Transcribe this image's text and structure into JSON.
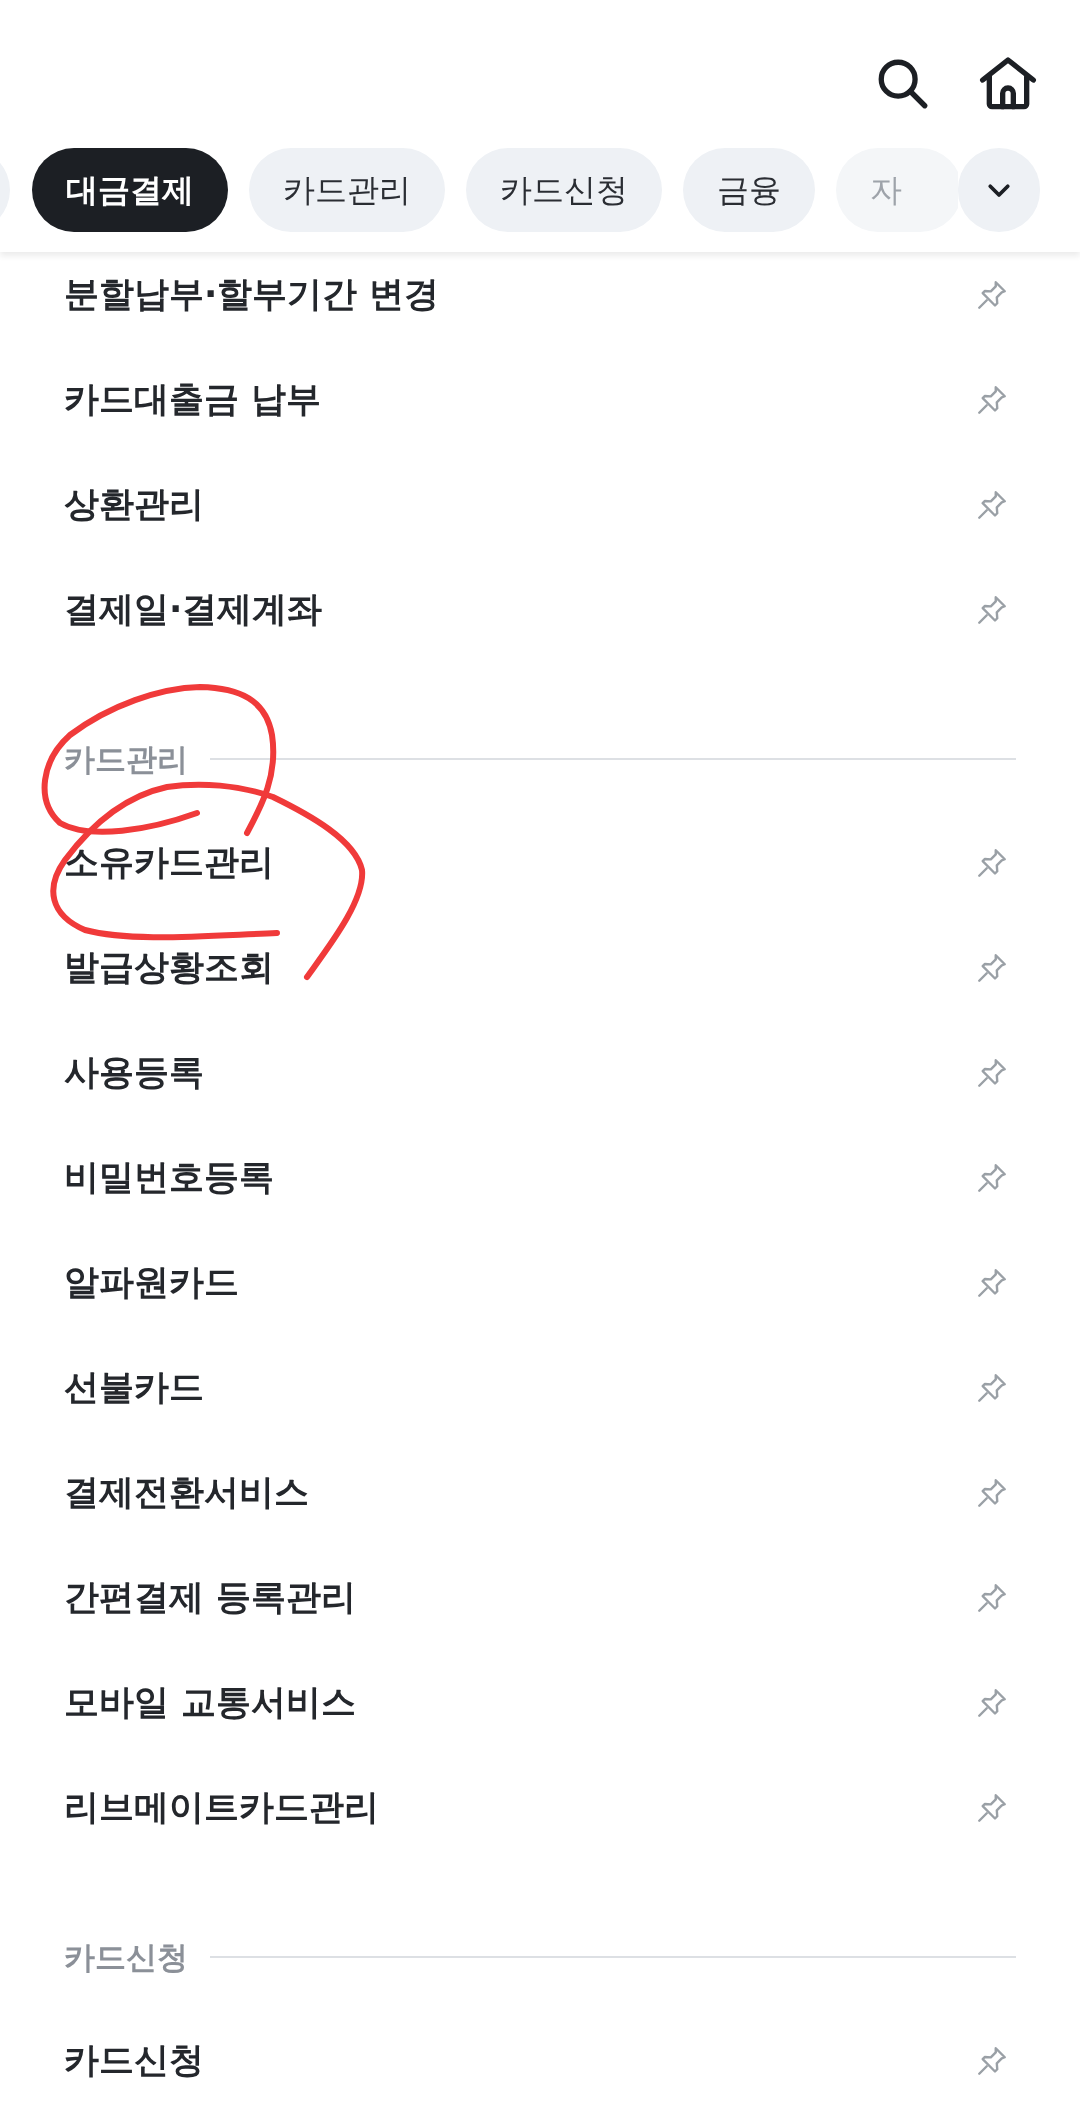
{
  "tabs": [
    {
      "label": "대금결제",
      "selected": true
    },
    {
      "label": "카드관리",
      "selected": false
    },
    {
      "label": "카드신청",
      "selected": false
    },
    {
      "label": "금융",
      "selected": false
    },
    {
      "label": "자",
      "selected": false
    }
  ],
  "sections": [
    {
      "items": [
        {
          "label": "분할납부·할부기간 변경",
          "pinned": false
        },
        {
          "label": "카드대출금 납부",
          "pinned": false
        },
        {
          "label": "상환관리",
          "pinned": false
        },
        {
          "label": "결제일·결제계좌",
          "pinned": false
        }
      ]
    },
    {
      "title": "카드관리",
      "items": [
        {
          "label": "소유카드관리",
          "pinned": false
        },
        {
          "label": "발급상황조회",
          "pinned": false
        },
        {
          "label": "사용등록",
          "pinned": false
        },
        {
          "label": "비밀번호등록",
          "pinned": false
        },
        {
          "label": "알파원카드",
          "pinned": false
        },
        {
          "label": "선불카드",
          "pinned": false
        },
        {
          "label": "결제전환서비스",
          "pinned": false
        },
        {
          "label": "간편결제 등록관리",
          "pinned": false
        },
        {
          "label": "모바일 교통서비스",
          "pinned": false
        },
        {
          "label": "리브메이트카드관리",
          "pinned": false
        }
      ]
    },
    {
      "title": "카드신청",
      "items": [
        {
          "label": "카드신청",
          "pinned": false
        }
      ]
    }
  ]
}
